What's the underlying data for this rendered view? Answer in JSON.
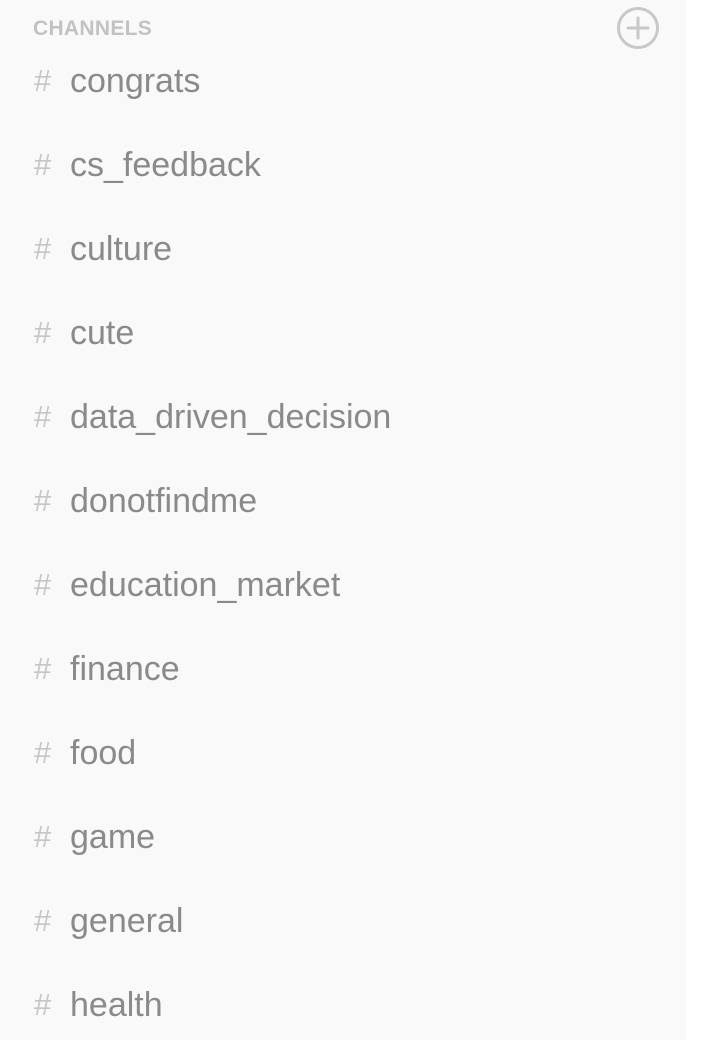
{
  "sidebar": {
    "section_title": "CHANNELS",
    "add_icon": "plus-circle-icon",
    "channels": [
      {
        "label": "congrats"
      },
      {
        "label": "cs_feedback"
      },
      {
        "label": "culture"
      },
      {
        "label": "cute"
      },
      {
        "label": "data_driven_decision"
      },
      {
        "label": "donotfindme"
      },
      {
        "label": "education_market"
      },
      {
        "label": "finance"
      },
      {
        "label": "food"
      },
      {
        "label": "game"
      },
      {
        "label": "general"
      },
      {
        "label": "health"
      }
    ],
    "channel_prefix": "#"
  },
  "colors": {
    "sidebar_bg": "#f9f9f9",
    "header_text": "#c2c2c2",
    "channel_text": "#8a8a8a",
    "hash_text": "#c6c6c6"
  }
}
